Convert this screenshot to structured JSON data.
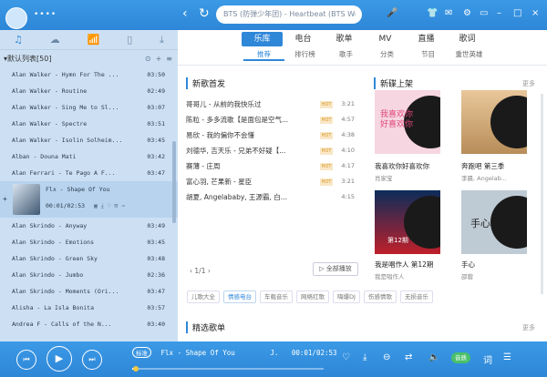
{
  "titlebar": {
    "username": "••••",
    "search_placeholder": "BTS (防弹少年团) - Heartbeat (BTS W",
    "search_icon": "search-icon"
  },
  "left_panel": {
    "playlist_name": "默认列表[50]",
    "songs": [
      {
        "title": "Alan Walker - Hymn For The ...",
        "duration": "03:50"
      },
      {
        "title": "Alan Walker - Routine",
        "duration": "02:49"
      },
      {
        "title": "Alan Walker - Sing Me to Sl...",
        "duration": "03:07"
      },
      {
        "title": "Alan Walker - Spectre",
        "duration": "03:51"
      },
      {
        "title": "Alan Walker - Isolin Solheim...",
        "duration": "03:45"
      },
      {
        "title": "Alban - Douna Mati",
        "duration": "03:42"
      },
      {
        "title": "Alan Ferrari - Te Pago A F...",
        "duration": "03:47"
      }
    ],
    "playing": {
      "title": "Flx - Shape Of You",
      "time": "00:01/02:53"
    },
    "songs_after": [
      {
        "title": "Alan Skrindo - Anyway",
        "duration": "03:49"
      },
      {
        "title": "Alan Skrindo - Emotions",
        "duration": "03:45"
      },
      {
        "title": "Alan Skrindo - Green Sky",
        "duration": "03:48"
      },
      {
        "title": "Alan Skrindo - Jumbo",
        "duration": "02:36"
      },
      {
        "title": "Alan Skrindo - Moments (Ori...",
        "duration": "03:47"
      },
      {
        "title": "Alisha - La Isla Bonita",
        "duration": "03:57"
      },
      {
        "title": "Andrea F - Calls of the N...",
        "duration": "03:40"
      }
    ]
  },
  "tabs": [
    "乐库",
    "电台",
    "歌单",
    "MV",
    "直播",
    "歌词"
  ],
  "subtabs": [
    "推荐",
    "排行榜",
    "歌手",
    "分类",
    "节目",
    "重世英雄"
  ],
  "new_songs": {
    "title": "新歌首发",
    "rows": [
      {
        "title": "哥哥儿 - 从前的我快乐过",
        "hot": "HOT",
        "duration": "3:21"
      },
      {
        "title": "陈粒 - 多多流歌【是面包是空气...",
        "hot": "HOT",
        "duration": "4:57"
      },
      {
        "title": "易欣 - 我的偏你不会懂",
        "hot": "HOT",
        "duration": "4:38"
      },
      {
        "title": "刘德华, 吉天乐 - 兄弟不好疑【...",
        "hot": "HOT",
        "duration": "4:10"
      },
      {
        "title": "赛薄 - 庄周",
        "hot": "HOT",
        "duration": "4:17"
      },
      {
        "title": "富心羽, 芒果新 - 星臣",
        "hot": "HOT",
        "duration": "3:21"
      },
      {
        "title": "胡夏, Angelababy, 王源霸, 白...",
        "hot": "",
        "duration": "4:15"
      }
    ],
    "pager": "1/1",
    "play_all": "全部播放"
  },
  "new_albums": {
    "title": "新碟上架",
    "more": "更多",
    "items": [
      {
        "title": "我喜欢你好喜欢你",
        "sub": "肖家宝",
        "art_text": "我喜欢你好喜欢你"
      },
      {
        "title": "奔跑吧 第三季",
        "sub": "李晨, Angelab...",
        "art_text": ""
      },
      {
        "title": "我是唱作人 第12期",
        "sub": "我是唱作人",
        "art_text": "第12期"
      },
      {
        "title": "手心",
        "sub": "邵蓉",
        "art_text": "手心"
      }
    ]
  },
  "categories": [
    "儿歌大全",
    "情感电台",
    "车载音乐",
    "网络红歌",
    "嗨爆DJ",
    "伤感情歌",
    "无损音乐"
  ],
  "selected_title": "精选歌单",
  "selected_more": "更多",
  "player": {
    "badge": "标准",
    "now_playing": "Flx - Shape Of You",
    "tag": "J.",
    "time": "00:01/02:53",
    "progress_fraction": 0.02,
    "quality": "音质"
  }
}
